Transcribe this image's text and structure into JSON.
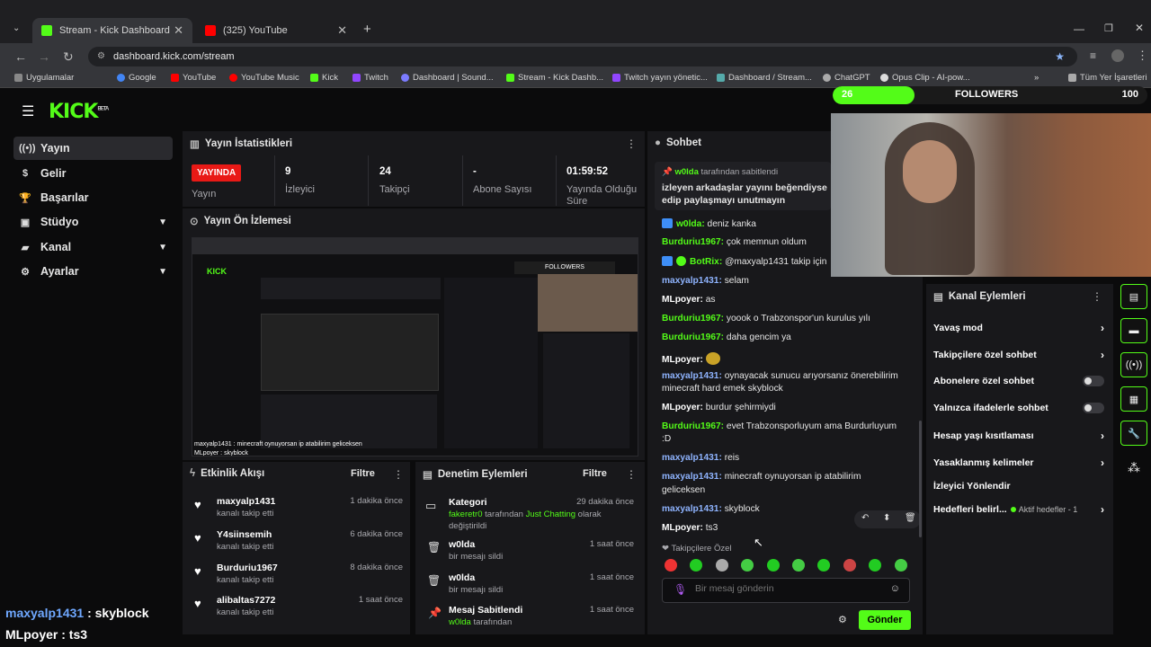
{
  "browser": {
    "tabs": [
      {
        "title": "Stream - Kick Dashboard"
      },
      {
        "title": "(325) YouTube"
      }
    ],
    "url": "dashboard.kick.com/stream",
    "bookmarks": [
      "Uygulamalar",
      "Google",
      "YouTube",
      "YouTube Music",
      "Kick",
      "Twitch",
      "Dashboard | Sound...",
      "Stream - Kick Dashb...",
      "Twitch yayın yönetic...",
      "Dashboard / Stream...",
      "ChatGPT",
      "Opus Clip - AI-pow..."
    ],
    "bookmarks_other": "Tüm Yer İşaretleri"
  },
  "app": {
    "logo": "KICK",
    "logo_beta": "BETA",
    "nav": [
      {
        "label": "Yayın",
        "icon": "broadcast-icon",
        "active": true
      },
      {
        "label": "Gelir",
        "icon": "revenue-icon"
      },
      {
        "label": "Başarılar",
        "icon": "trophy-icon"
      },
      {
        "label": "Stüdyo",
        "icon": "studio-icon",
        "chevron": true
      },
      {
        "label": "Kanal",
        "icon": "channel-icon",
        "chevron": true
      },
      {
        "label": "Ayarlar",
        "icon": "settings-icon",
        "chevron": true
      }
    ]
  },
  "stats": {
    "title": "Yayın İstatistikleri",
    "live_badge": "YAYINDA",
    "items": [
      {
        "value": "",
        "label": "Yayın"
      },
      {
        "value": "9",
        "label": "İzleyici"
      },
      {
        "value": "24",
        "label": "Takipçi"
      },
      {
        "value": "-",
        "label": "Abone Sayısı"
      },
      {
        "value": "01:59:52",
        "label": "Yayında Olduğu Süre"
      }
    ]
  },
  "preview": {
    "title": "Yayın Ön İzlemesi",
    "caption1": "maxyalp1431 : minecraft oynuyorsan ip atabilirim geliceksen",
    "caption2": "MLpoyer : skyblock"
  },
  "activity": {
    "title": "Etkinlik Akışı",
    "filter": "Filtre",
    "items": [
      {
        "name": "maxyalp1431",
        "sub": "kanalı takip etti",
        "time": "1 dakika önce"
      },
      {
        "name": "Y4siinsemih",
        "sub": "kanalı takip etti",
        "time": "6 dakika önce"
      },
      {
        "name": "Burduriu1967",
        "sub": "kanalı takip etti",
        "time": "8 dakika önce"
      },
      {
        "name": "alibaltas7272",
        "sub": "kanalı takip etti",
        "time": "1 saat önce"
      }
    ]
  },
  "moderation": {
    "title": "Denetim Eylemleri",
    "filter": "Filtre",
    "items": [
      {
        "name": "Kategori",
        "sub_user": "fakeretr0",
        "sub": " tarafından ",
        "sub_highlight": "Just Chatting",
        "sub_end": " olarak",
        "sub2": "değiştirildi",
        "time": "29 dakika önce"
      },
      {
        "name": "w0lda",
        "sub": "bir mesajı sildi",
        "time": "1 saat önce"
      },
      {
        "name": "w0lda",
        "sub": "bir mesajı sildi",
        "time": "1 saat önce"
      },
      {
        "name": "Mesaj Sabitlendi",
        "sub_user": "w0lda",
        "sub": " tarafından",
        "time": "1 saat önce"
      }
    ]
  },
  "chat": {
    "title": "Sohbet",
    "pinned_by": "w0lda",
    "pinned_label": " tarafından sabitlendi",
    "pinned_text1": "izleyen arkadaşlar yayını beğendiyse",
    "pinned_text2": "edip paylaşmayı unutmayın",
    "messages": [
      {
        "user": "w0lda",
        "cls": "u-g",
        "text": "deniz kanka"
      },
      {
        "user": "Burduriu1967",
        "cls": "u-g",
        "text": "çok memnun oldum"
      },
      {
        "user": "BotRix",
        "cls": "u-g",
        "text": "@maxyalp1431 takip için"
      },
      {
        "user": "maxyalp1431",
        "cls": "u-b",
        "text": "selam"
      },
      {
        "user": "MLpoyer",
        "cls": "u-w",
        "text": "as"
      },
      {
        "user": "Burduriu1967",
        "cls": "u-g",
        "text": "yoook o Trabzonspor'un kurulus yılı"
      },
      {
        "user": "Burduriu1967",
        "cls": "u-g",
        "text": "daha gencim ya"
      },
      {
        "user": "MLpoyer",
        "cls": "u-w",
        "text": ""
      },
      {
        "user": "maxyalp1431",
        "cls": "u-b",
        "text": "oynayacak sunucu arıyorsanız önerebilirim"
      },
      {
        "user": "",
        "cls": "",
        "text": "minecraft hard emek skyblock"
      },
      {
        "user": "MLpoyer",
        "cls": "u-w",
        "text": "burdur şehirmiydi"
      },
      {
        "user": "Burduriu1967",
        "cls": "u-g",
        "text": "evet Trabzonsporluyum ama Burdurluyum"
      },
      {
        "user": "",
        "cls": "",
        "text": ":D"
      },
      {
        "user": "maxyalp1431",
        "cls": "u-b",
        "text": "reis"
      },
      {
        "user": "maxyalp1431",
        "cls": "u-b",
        "text": "minecraft oynuyorsan ip atabilirim"
      },
      {
        "user": "",
        "cls": "",
        "text": "geliceksen"
      },
      {
        "user": "maxyalp1431",
        "cls": "u-b",
        "text": "skyblock"
      },
      {
        "user": "MLpoyer",
        "cls": "u-w",
        "text": "ts3"
      }
    ],
    "followers_only": "Takipçilere Özel",
    "input_placeholder": "Bir mesaj gönderin",
    "send": "Gönder"
  },
  "followers_goal": {
    "current": "26",
    "label": "FOLLOWERS",
    "target": "100",
    "progress": 0.26
  },
  "channel_actions": {
    "title": "Kanal Eylemleri",
    "items": [
      {
        "label": "Yavaş mod",
        "type": "arrow"
      },
      {
        "label": "Takipçilere özel sohbet",
        "type": "arrow"
      },
      {
        "label": "Abonelere özel sohbet",
        "type": "toggle"
      },
      {
        "label": "Yalnızca ifadelerle sohbet",
        "type": "toggle"
      },
      {
        "label": "Hesap yaşı kısıtlaması",
        "type": "arrow"
      },
      {
        "label": "Yasaklanmış kelimeler",
        "type": "arrow"
      },
      {
        "label": "İzleyici Yönlendir",
        "type": "none"
      },
      {
        "label": "Hedefleri belirl...",
        "type": "goal",
        "extra": "Aktif hedefler - 1"
      }
    ]
  },
  "overlay": {
    "line1_user": "maxyalp1431",
    "line1_text": " : skyblock",
    "line2_user": "MLpoyer",
    "line2_text": " : ts3"
  }
}
